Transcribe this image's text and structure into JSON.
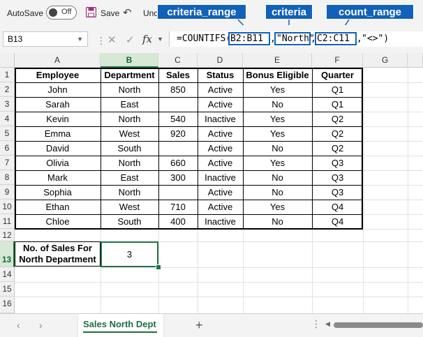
{
  "toolbar": {
    "autosave_label": "AutoSave",
    "autosave_state": "Off",
    "save_label": "Save",
    "undo_label": "Und"
  },
  "callouts": {
    "criteria_range": "criteria_range",
    "criteria": "criteria",
    "count_range": "count_range"
  },
  "formula_bar": {
    "name_box": "B13",
    "fx_label": "fx",
    "formula_prefix": "=COUNTIFS(",
    "arg1": "B2:B11",
    "arg2": "\"North\"",
    "arg3": "C2:C11",
    "formula_suffix": "\"<>\")"
  },
  "columns": [
    "A",
    "B",
    "C",
    "D",
    "E",
    "F",
    "G"
  ],
  "rows": [
    "1",
    "2",
    "3",
    "4",
    "5",
    "6",
    "7",
    "8",
    "9",
    "10",
    "11",
    "12",
    "13",
    "14",
    "15",
    "16"
  ],
  "table": {
    "headers": [
      "Employee",
      "Department",
      "Sales",
      "Status",
      "Bonus Eligible",
      "Quarter"
    ],
    "rows": [
      [
        "John",
        "North",
        "850",
        "Active",
        "Yes",
        "Q1"
      ],
      [
        "Sarah",
        "East",
        "",
        "Active",
        "No",
        "Q1"
      ],
      [
        "Kevin",
        "North",
        "540",
        "Inactive",
        "Yes",
        "Q2"
      ],
      [
        "Emma",
        "West",
        "920",
        "Active",
        "Yes",
        "Q2"
      ],
      [
        "David",
        "South",
        "",
        "Active",
        "No",
        "Q2"
      ],
      [
        "Olivia",
        "North",
        "660",
        "Active",
        "Yes",
        "Q3"
      ],
      [
        "Mark",
        "East",
        "300",
        "Inactive",
        "No",
        "Q3"
      ],
      [
        "Sophia",
        "North",
        "",
        "Active",
        "No",
        "Q3"
      ],
      [
        "Ethan",
        "West",
        "710",
        "Active",
        "Yes",
        "Q4"
      ],
      [
        "Chloe",
        "South",
        "400",
        "Inactive",
        "No",
        "Q4"
      ]
    ]
  },
  "summary": {
    "label": "No. of Sales For North Department",
    "value": "3"
  },
  "sheet_tabs": {
    "active": "Sales North Dept",
    "add": "+"
  },
  "colors": {
    "accent_blue": "#1261b8",
    "excel_green": "#217346"
  }
}
